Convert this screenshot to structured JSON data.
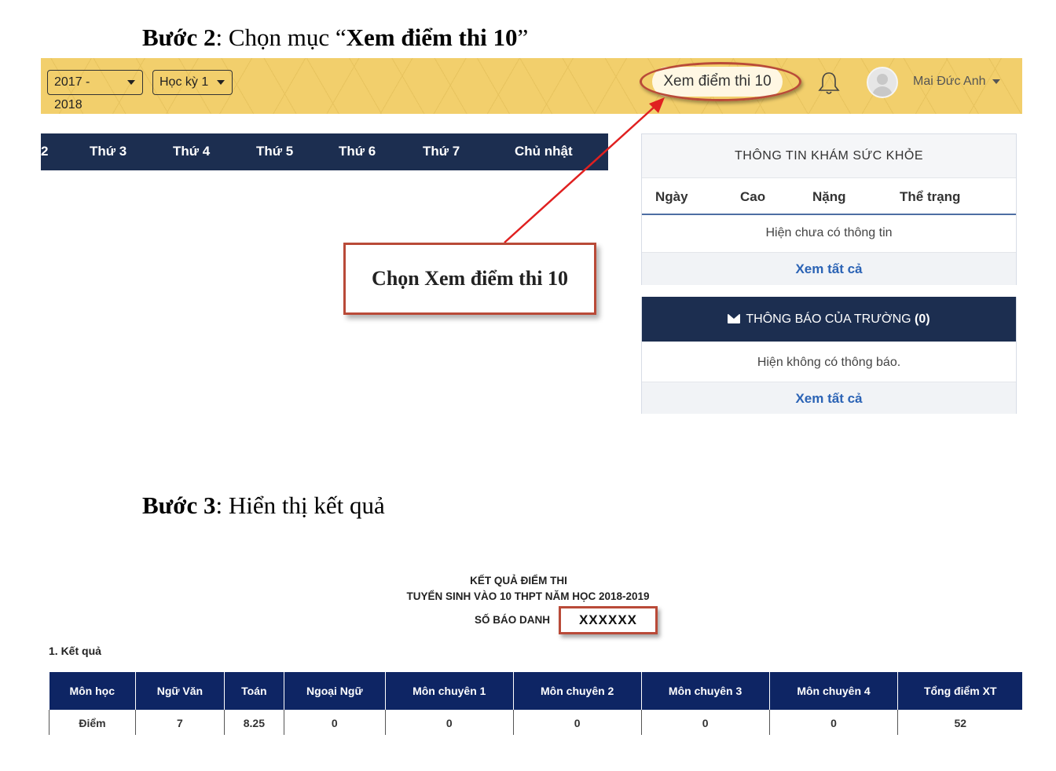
{
  "step2": {
    "bold": "Bước 2",
    "text": ": Chọn mục “",
    "highlight": "Xem điểm thi 10",
    "end": "”"
  },
  "topbar": {
    "year": "2017 - 2018",
    "term": "Học kỳ 1",
    "exam_button": "Xem điểm thi 10",
    "user_name": "Mai Đức Anh"
  },
  "weekdays": [
    "2",
    "Thứ 3",
    "Thứ 4",
    "Thứ 5",
    "Thứ 6",
    "Thứ 7",
    "Chủ nhật"
  ],
  "callout": "Chọn Xem điểm thi 10",
  "health": {
    "title": "THÔNG TIN KHÁM SỨC KHỎE",
    "columns": [
      "Ngày",
      "Cao",
      "Nặng",
      "Thể trạng"
    ],
    "empty": "Hiện chưa có thông tin",
    "view_all": "Xem tất cả"
  },
  "notice": {
    "title": "THÔNG BÁO CỦA TRƯỜNG",
    "count": "(0)",
    "empty": "Hiện không có thông báo.",
    "view_all": "Xem tất cả"
  },
  "step3": {
    "bold": "Bước 3",
    "text": ": Hiển thị kết quả"
  },
  "results": {
    "title": "KẾT QUẢ ĐIỂM THI",
    "subtitle": "TUYỂN SINH VÀO 10 THPT NĂM HỌC 2018-2019",
    "sbd_label": "SỐ BÁO DANH",
    "sbd_value": "XXXXXX",
    "section": "1. Kết quả",
    "headers": [
      "Môn học",
      "Ngữ Văn",
      "Toán",
      "Ngoại Ngữ",
      "Môn chuyên 1",
      "Môn chuyên 2",
      "Môn chuyên 3",
      "Môn chuyên 4",
      "Tổng điểm XT"
    ],
    "row": [
      "Điểm",
      "7",
      "8.25",
      "0",
      "0",
      "0",
      "0",
      "0",
      "52"
    ]
  },
  "colors": {
    "topbar": "#f2cf6c",
    "navy": "#1c2e50",
    "table_header": "#0e2564",
    "highlight": "#b94a38",
    "link": "#2b63b5"
  }
}
